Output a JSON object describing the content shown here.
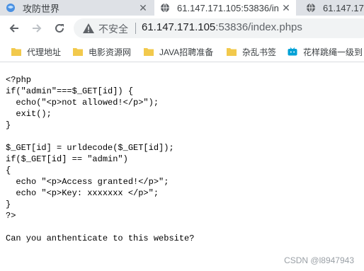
{
  "tabs": [
    {
      "title": "攻防世界",
      "icon": "globe-icon"
    },
    {
      "title": "61.147.171.105:53836/in",
      "icon": "globe-icon"
    },
    {
      "title": "61.147.17",
      "icon": "globe-icon"
    }
  ],
  "toolbar": {
    "insecure_label": "不安全",
    "url_host": "61.147.171.105",
    "url_rest": ":53836/index.phps"
  },
  "bookmarks": [
    {
      "label": "代理地址"
    },
    {
      "label": "电影资源网"
    },
    {
      "label": "JAVA招聘准备"
    },
    {
      "label": "杂乱书签"
    },
    {
      "label": "花样跳绳一级到"
    }
  ],
  "page": {
    "source_code": "<?php\nif(\"admin\"===$_GET[id]) {\n  echo(\"<p>not allowed!</p>\");\n  exit();\n}\n\n$_GET[id] = urldecode($_GET[id]);\nif($_GET[id] == \"admin\")\n{\n  echo \"<p>Access granted!</p>\";\n  echo \"<p>Key: xxxxxxx </p>\";\n}\n?>",
    "question": "Can you anthenticate to this website?"
  },
  "watermark": "CSDN @l8947943",
  "colors": {
    "tabstrip": "#dee1e6",
    "omnibox": "#f1f3f4",
    "folder": "#f2c94c",
    "tab_icon_blue": "#1a73e8"
  }
}
